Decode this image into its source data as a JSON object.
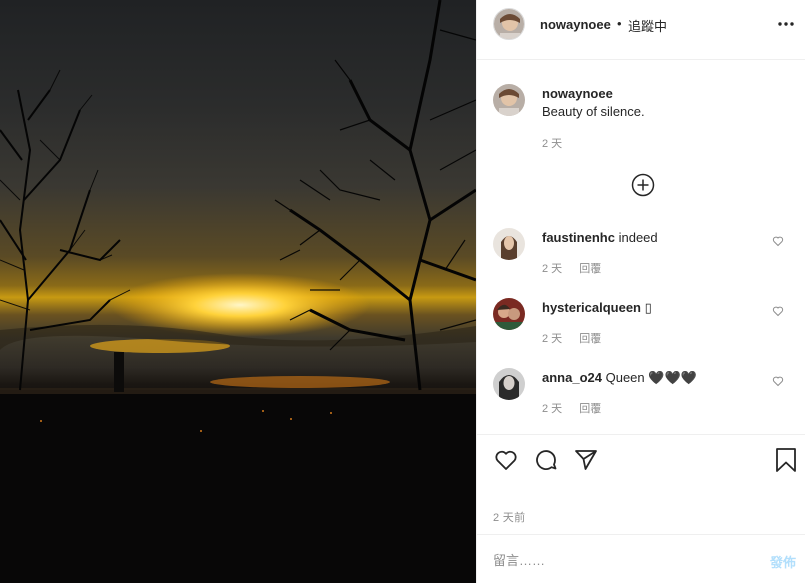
{
  "post": {
    "username": "nowaynoee",
    "separator": "•",
    "follow_status": "追蹤中",
    "more_icon": "more-horizontal-icon"
  },
  "caption": {
    "username": "nowaynoee",
    "text": "Beauty of silence.",
    "time": "2 天"
  },
  "load_more_icon": "plus-circle-icon",
  "comments": [
    {
      "username": "faustinenhc",
      "text": "indeed",
      "time": "2 天",
      "reply": "回覆"
    },
    {
      "username": "hystericalqueen",
      "text": "▯",
      "time": "2 天",
      "reply": "回覆"
    },
    {
      "username": "anna_o24",
      "text": "Queen 🖤🖤🖤",
      "time": "2 天",
      "reply": "回覆"
    }
  ],
  "actions": {
    "like_icon": "heart-icon",
    "comment_icon": "comment-icon",
    "share_icon": "send-icon",
    "save_icon": "bookmark-icon"
  },
  "posted_time": "2 天前",
  "comment_input": {
    "placeholder": "留言……",
    "post_label": "發佈"
  },
  "colors": {
    "accent_disabled": "#b2dffc",
    "muted_text": "#8e8e8e",
    "border": "#efefef"
  }
}
